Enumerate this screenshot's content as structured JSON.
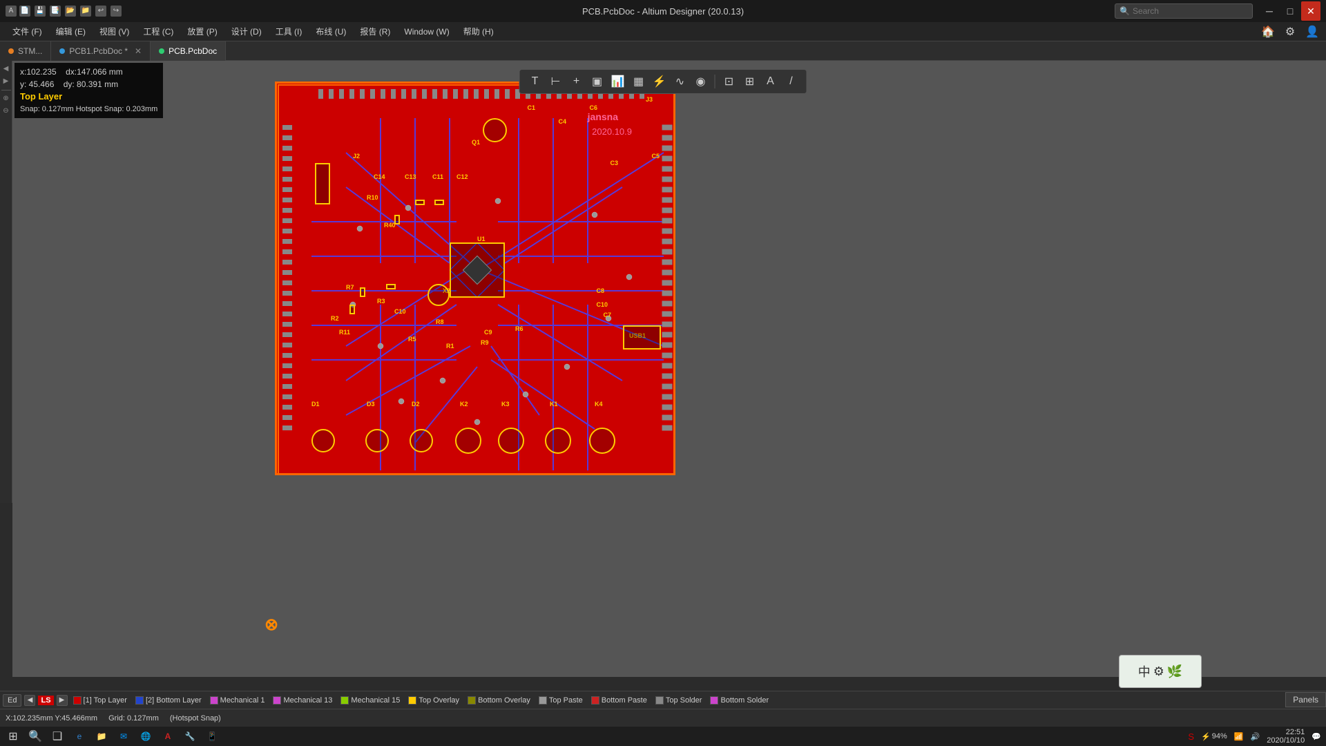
{
  "titleBar": {
    "title": "PCB.PcbDoc - Altium Designer (20.0.13)",
    "searchPlaceholder": "Search",
    "minimizeLabel": "─",
    "maximizeLabel": "□",
    "closeLabel": "✕"
  },
  "menuBar": {
    "items": [
      "文件 (F)",
      "编辑 (E)",
      "视图 (V)",
      "工程 (C)",
      "放置 (P)",
      "设计 (D)",
      "工具 (I)",
      "布线 (U)",
      "报告 (R)",
      "Window (W)",
      "帮助 (H)"
    ]
  },
  "tabs": [
    {
      "label": "STM...",
      "color": "orange",
      "active": false
    },
    {
      "label": "PCB1.PcbDoc *",
      "color": "blue",
      "active": false
    },
    {
      "label": "PCB.PcbDoc",
      "color": "green",
      "active": true
    }
  ],
  "coordBox": {
    "x": "x:102.235",
    "dx": "dx:147.066 mm",
    "y": "y: 45.466",
    "dy": "dy: 80.391  mm",
    "layer": "Top Layer",
    "snap": "Snap: 0.127mm Hotspot Snap: 0.203mm"
  },
  "pcb": {
    "jansnaText": "jansna",
    "dateText": "2020.10.9",
    "components": [
      "Q1",
      "U1",
      "X2",
      "J2",
      "J3",
      "C1",
      "C4",
      "C5",
      "C6",
      "C7",
      "C8",
      "C10",
      "C11",
      "C12",
      "C13",
      "C14",
      "R2",
      "R3",
      "R4",
      "R5",
      "R6",
      "R7",
      "R8",
      "R9",
      "R10",
      "R11",
      "D1",
      "D2",
      "D3",
      "K1",
      "K2",
      "K3",
      "K4",
      "USB1"
    ],
    "originMarker": "⊗"
  },
  "layers": [
    {
      "name": "[1] Top Layer",
      "color": "#cc0000"
    },
    {
      "name": "[2] Bottom Layer",
      "color": "#0000cc"
    },
    {
      "name": "Mechanical 1",
      "color": "#cc44cc"
    },
    {
      "name": "Mechanical 13",
      "color": "#cc44cc"
    },
    {
      "name": "Mechanical 15",
      "color": "#88cc00"
    },
    {
      "name": "Top Overlay",
      "color": "#ffcc00"
    },
    {
      "name": "Bottom Overlay",
      "color": "#888800"
    },
    {
      "name": "Top Paste",
      "color": "#888888"
    },
    {
      "name": "Bottom Paste",
      "color": "#cc0000"
    },
    {
      "name": "Top Solder",
      "color": "#888888"
    },
    {
      "name": "Bottom Solder",
      "color": "#cc44cc"
    }
  ],
  "statusBar": {
    "coords": "X:102.235mm Y:45.466mm",
    "grid": "Grid: 0.127mm",
    "hotspot": "(Hotspot Snap)"
  },
  "taskbar": {
    "time": "22:51",
    "date": "2020/10/10",
    "batteryPercent": "94%",
    "startLabel": "⊞",
    "searchLabel": "🔍",
    "taskviewLabel": "❑"
  },
  "panelsBtn": "Panels",
  "editBtn": "Ed",
  "lsIndicator": "LS"
}
